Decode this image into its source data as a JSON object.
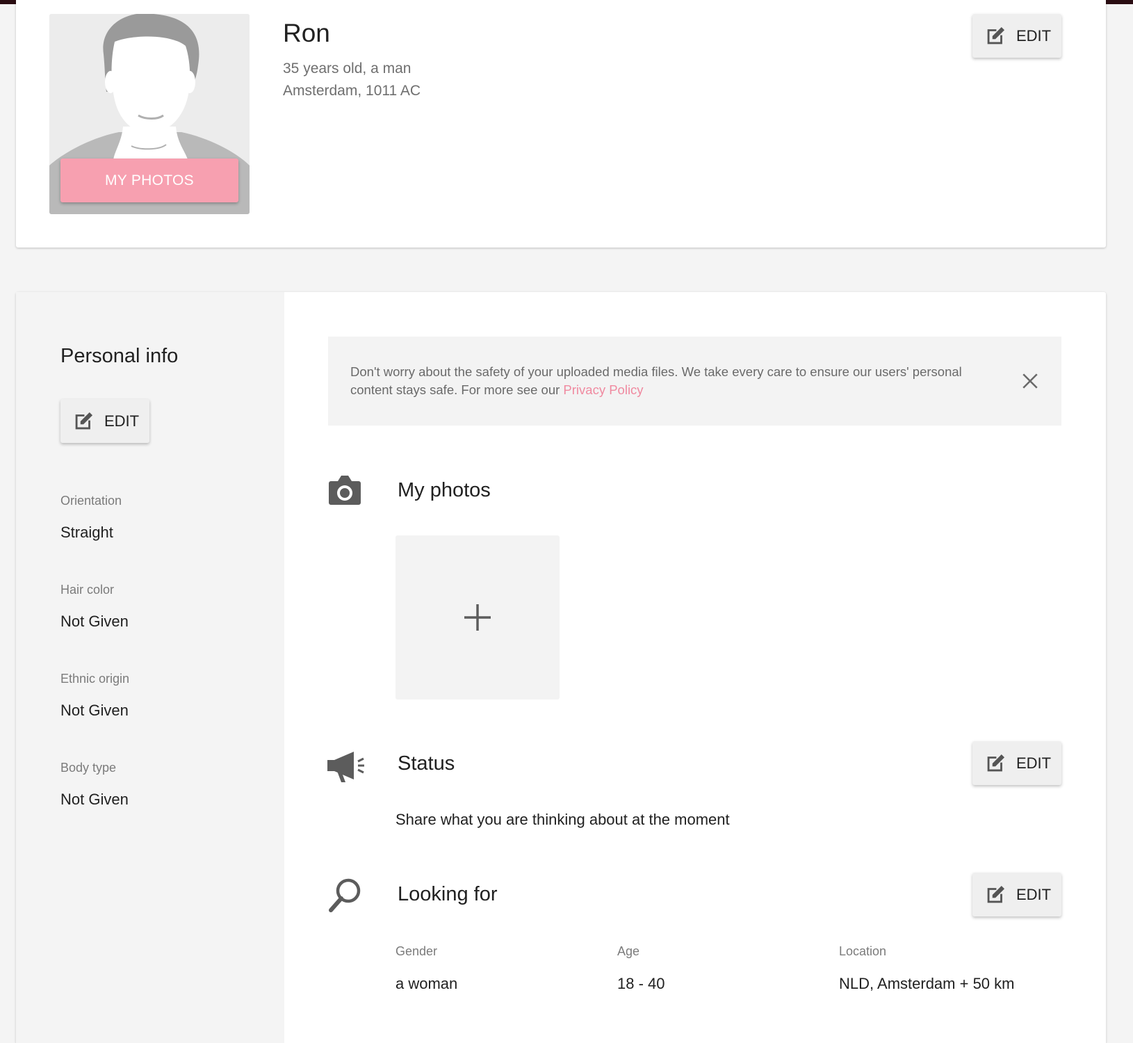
{
  "colors": {
    "accent_pink": "#f7a0b0",
    "link_pink": "#f08aa0",
    "background": "#f4f4f4"
  },
  "profile": {
    "name": "Ron",
    "age_gender": "35 years old, a man",
    "location": "Amsterdam, 1011 AC",
    "my_photos_button": "MY PHOTOS",
    "edit_label": "EDIT",
    "avatar_icon": "default-male-avatar"
  },
  "personal_info": {
    "title": "Personal info",
    "edit_label": "EDIT",
    "fields": [
      {
        "label": "Orientation",
        "value": "Straight"
      },
      {
        "label": "Hair color",
        "value": "Not Given"
      },
      {
        "label": "Ethnic origin",
        "value": "Not Given"
      },
      {
        "label": "Body type",
        "value": "Not Given"
      }
    ]
  },
  "notice": {
    "text": "Don't worry about the safety of your uploaded media files. We take every care to ensure our users' personal content stays safe. For more see our ",
    "link": "Privacy Policy",
    "close_icon": "close-icon"
  },
  "photos": {
    "title": "My photos",
    "icon": "camera-icon",
    "add_icon": "plus-icon"
  },
  "status": {
    "title": "Status",
    "icon": "megaphone-icon",
    "edit_label": "EDIT",
    "text": "Share what you are thinking about at the moment"
  },
  "looking_for": {
    "title": "Looking for",
    "icon": "search-icon",
    "edit_label": "EDIT",
    "columns": [
      {
        "label": "Gender",
        "value": "a woman"
      },
      {
        "label": "Age",
        "value": "18 - 40"
      },
      {
        "label": "Location",
        "value": "NLD, Amsterdam + 50 km"
      }
    ]
  }
}
